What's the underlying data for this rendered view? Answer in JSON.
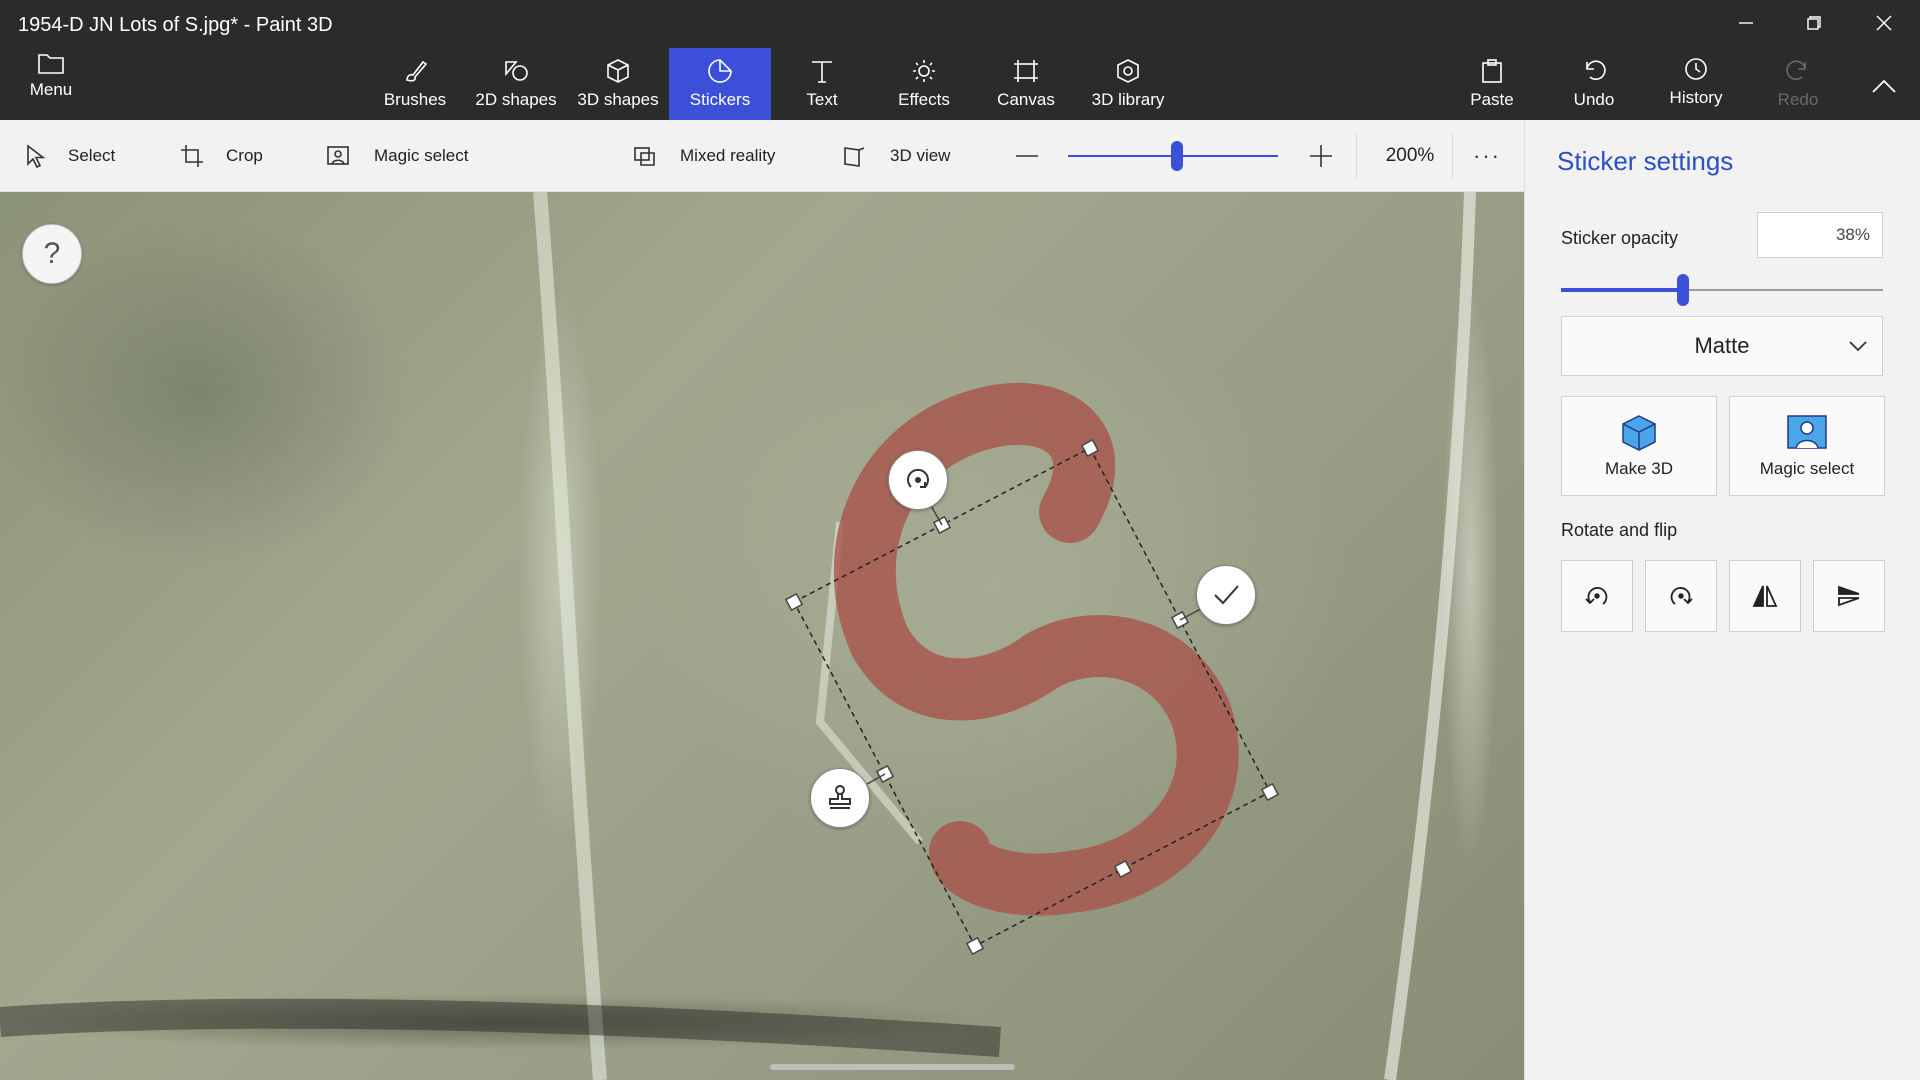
{
  "window": {
    "title": "1954-D JN Lots of S.jpg* - Paint 3D"
  },
  "menu": {
    "label": "Menu"
  },
  "main_tools": [
    {
      "label": "Brushes",
      "icon": "brush-icon"
    },
    {
      "label": "2D shapes",
      "icon": "2d-shapes-icon"
    },
    {
      "label": "3D shapes",
      "icon": "3d-shapes-icon"
    },
    {
      "label": "Stickers",
      "icon": "stickers-icon",
      "active": true
    },
    {
      "label": "Text",
      "icon": "text-icon"
    },
    {
      "label": "Effects",
      "icon": "effects-icon"
    },
    {
      "label": "Canvas",
      "icon": "canvas-icon"
    },
    {
      "label": "3D library",
      "icon": "3d-library-icon"
    }
  ],
  "right_tools": {
    "paste": "Paste",
    "undo": "Undo",
    "history": "History",
    "redo": "Redo"
  },
  "secondary_toolbar": {
    "select": "Select",
    "crop": "Crop",
    "magic_select": "Magic select",
    "mixed_reality": "Mixed reality",
    "view_3d": "3D view",
    "zoom_value": "200%",
    "zoom_level": 0.52,
    "more": "···"
  },
  "canvas": {
    "help": "?"
  },
  "sticker_panel": {
    "title": "Sticker settings",
    "opacity_label": "Sticker opacity",
    "opacity_value": "38%",
    "opacity": 0.38,
    "finish": "Matte",
    "make_3d": "Make 3D",
    "magic_select": "Magic select",
    "rotate_flip_label": "Rotate and flip"
  },
  "colors": {
    "accent": "#3b4fd8",
    "title_bar": "#2b2b2b",
    "panel_bg": "#f2f2f2",
    "sticker": "#a8524a"
  }
}
